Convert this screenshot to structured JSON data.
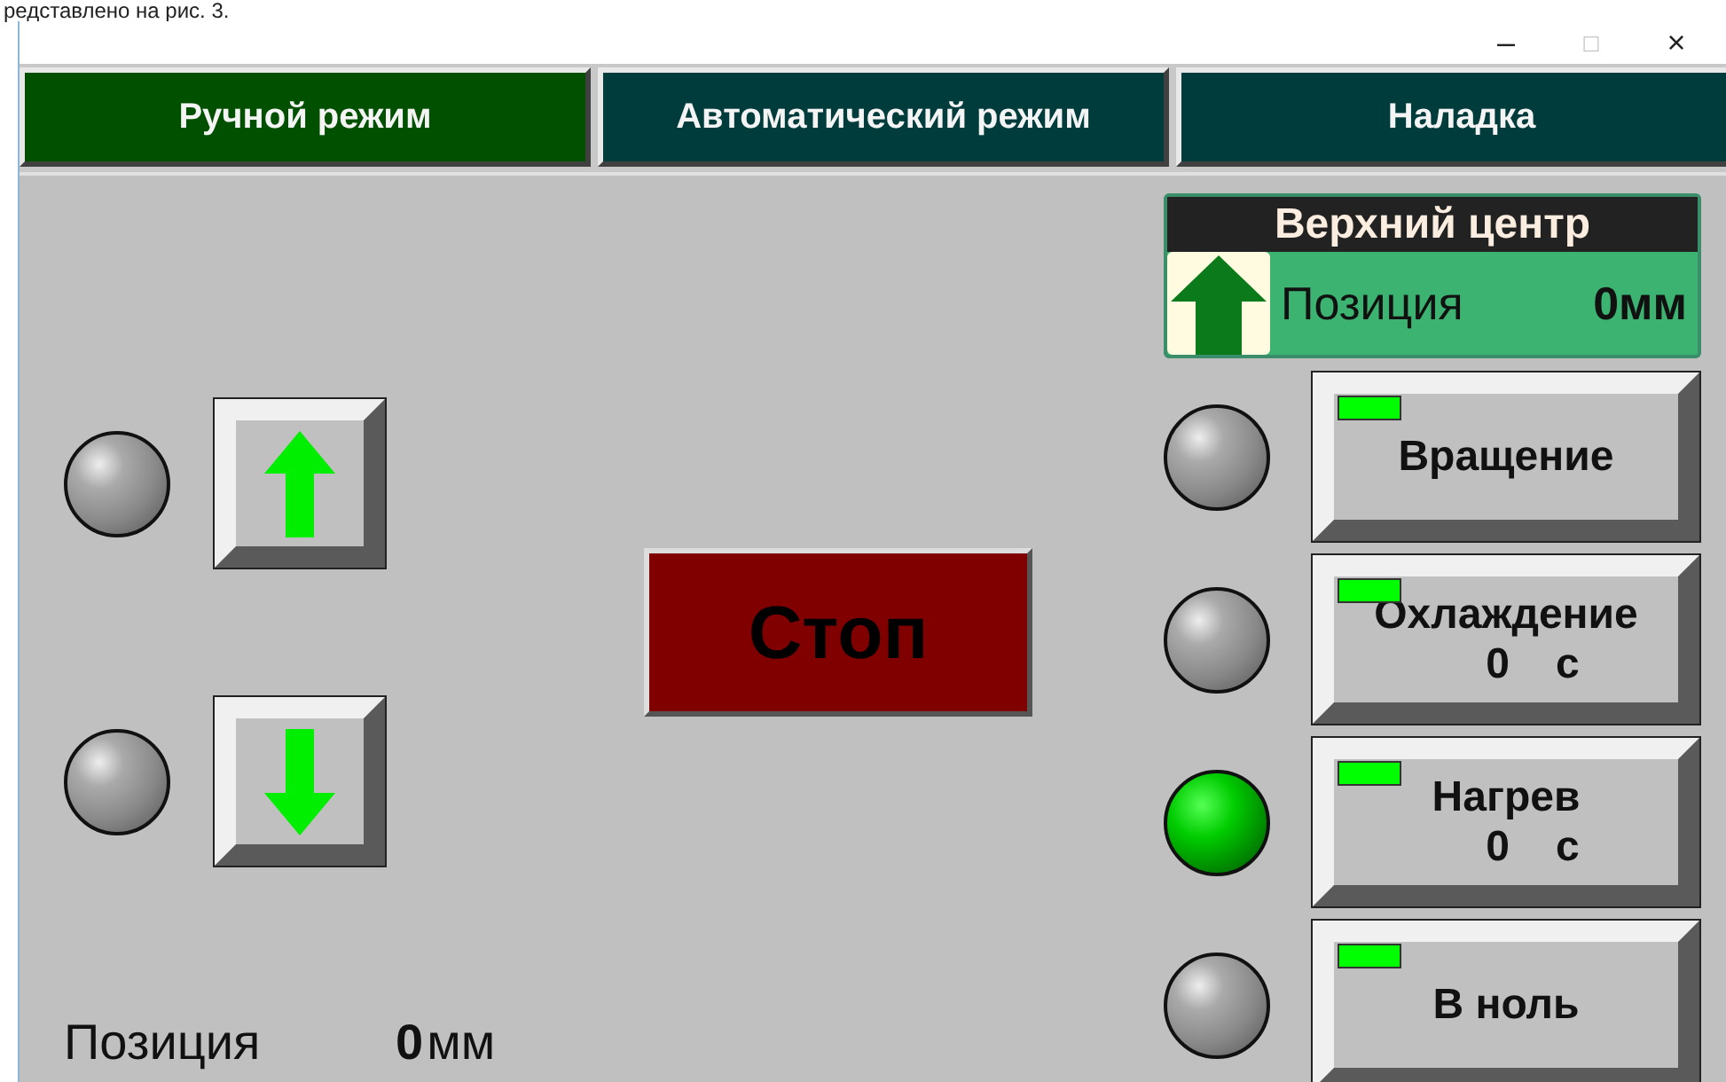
{
  "document_text": "редставлено на рис. 3.",
  "window": {
    "controls": [
      "–",
      "□",
      "×"
    ]
  },
  "tabs": [
    {
      "label": "Ручной режим",
      "selected": true
    },
    {
      "label": "Автоматический режим",
      "selected": false
    },
    {
      "label": "Наладка",
      "selected": false
    }
  ],
  "manual": {
    "jog_rows": [
      {
        "kind": "up",
        "lamp_on": false
      },
      {
        "kind": "down",
        "lamp_on": false
      }
    ],
    "position": {
      "label": "Позиция",
      "value": "0",
      "unit": "мм"
    }
  },
  "stop_button": {
    "label": "Стоп"
  },
  "upper_center": {
    "title": "Верхний центр",
    "label": "Позиция",
    "value": "0мм"
  },
  "functions": [
    {
      "label": "Вращение",
      "lamp_on": false
    },
    {
      "label": "Охлаждение",
      "value": "0",
      "unit": "с",
      "lamp_on": false
    },
    {
      "label": "Нагрев",
      "value": "0",
      "unit": "с",
      "lamp_on": true
    },
    {
      "label": "В ноль",
      "lamp_on": false
    }
  ]
}
